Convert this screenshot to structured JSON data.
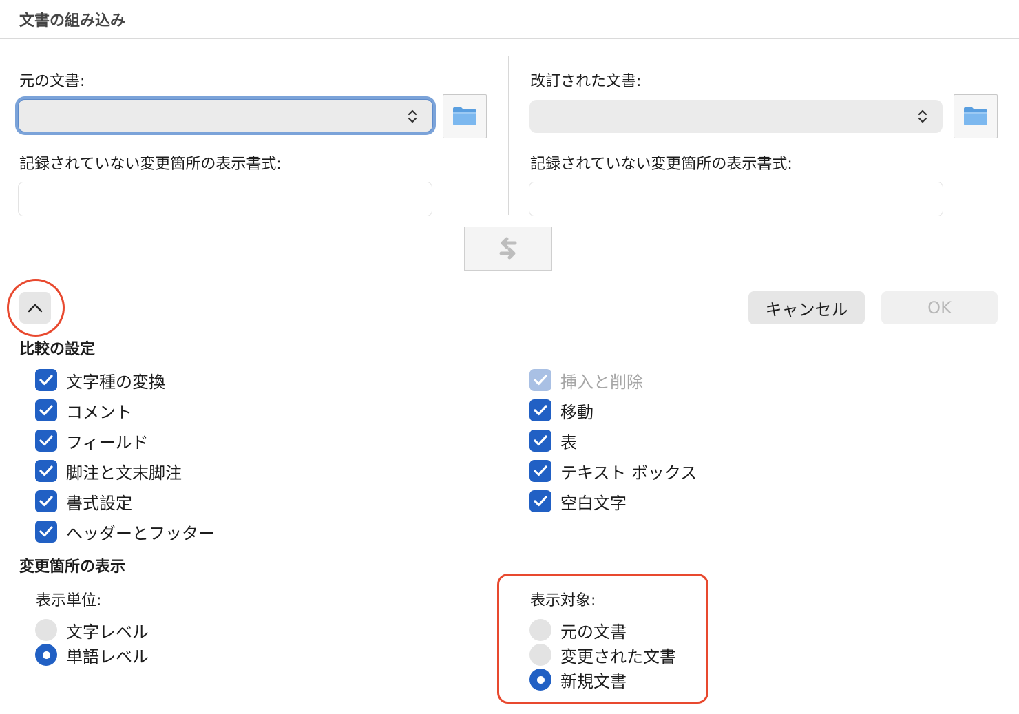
{
  "dialog": {
    "title": "文書の組み込み"
  },
  "original": {
    "label": "元の文書:",
    "format_label": "記録されていない変更箇所の表示書式:"
  },
  "revised": {
    "label": "改訂された文書:",
    "format_label": "記録されていない変更箇所の表示書式:"
  },
  "buttons": {
    "cancel": "キャンセル",
    "ok": "OK"
  },
  "compare_settings": {
    "heading": "比較の設定",
    "left": [
      {
        "label": "文字種の変換",
        "checked": true
      },
      {
        "label": "コメント",
        "checked": true
      },
      {
        "label": "フィールド",
        "checked": true
      },
      {
        "label": "脚注と文末脚注",
        "checked": true
      },
      {
        "label": "書式設定",
        "checked": true
      },
      {
        "label": "ヘッダーとフッター",
        "checked": true
      }
    ],
    "right": [
      {
        "label": "挿入と削除",
        "checked": true,
        "disabled": true
      },
      {
        "label": "移動",
        "checked": true
      },
      {
        "label": "表",
        "checked": true
      },
      {
        "label": "テキスト ボックス",
        "checked": true
      },
      {
        "label": "空白文字",
        "checked": true
      }
    ]
  },
  "show_changes": {
    "heading": "変更箇所の表示",
    "level": {
      "label": "表示単位:",
      "options": [
        {
          "label": "文字レベル",
          "selected": false
        },
        {
          "label": "単語レベル",
          "selected": true
        }
      ]
    },
    "target": {
      "label": "表示対象:",
      "options": [
        {
          "label": "元の文書",
          "selected": false
        },
        {
          "label": "変更された文書",
          "selected": false
        },
        {
          "label": "新規文書",
          "selected": true
        }
      ]
    }
  },
  "colors": {
    "accent": "#2160c4",
    "annotation": "#e8492f",
    "focus_ring": "#7ba3d9"
  },
  "icons": {
    "folder": "folder-icon",
    "swap": "swap-arrows-icon",
    "collapse": "chevron-up-icon",
    "updown": "updown-chevron-icon",
    "check": "checkmark-icon"
  }
}
